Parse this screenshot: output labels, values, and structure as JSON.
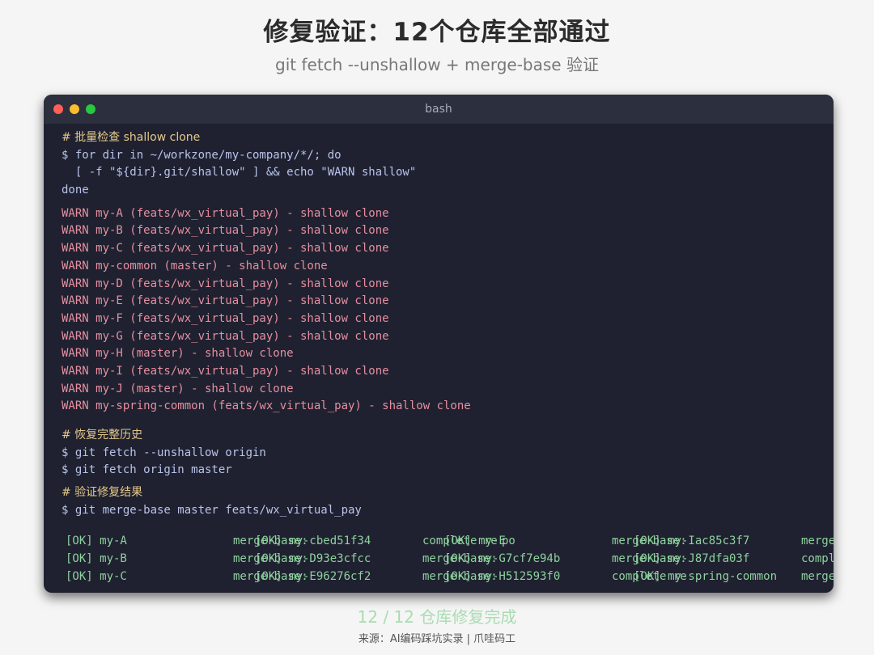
{
  "header": {
    "title": "修复验证：12个仓库全部通过",
    "subtitle": "git fetch --unshallow + merge-base 验证"
  },
  "window": {
    "title": "bash",
    "buttons": [
      "close",
      "minimize",
      "maximize"
    ]
  },
  "terminal": {
    "block1": {
      "comment": "# 批量检查 shallow clone",
      "cmd1": "$ for dir in ~/workzone/my-company/*/; do",
      "cmd2": "  [ -f \"${dir}.git/shallow\" ] && echo \"WARN shallow\"",
      "cmd3": "done"
    },
    "warnings": [
      "WARN my-A (feats/wx_virtual_pay) - shallow clone",
      "WARN my-B (feats/wx_virtual_pay) - shallow clone",
      "WARN my-C (feats/wx_virtual_pay) - shallow clone",
      "WARN my-common (master) - shallow clone",
      "WARN my-D (feats/wx_virtual_pay) - shallow clone",
      "WARN my-E (feats/wx_virtual_pay) - shallow clone",
      "WARN my-F (feats/wx_virtual_pay) - shallow clone",
      "WARN my-G (feats/wx_virtual_pay) - shallow clone",
      "WARN my-H (master) - shallow clone",
      "WARN my-I (feats/wx_virtual_pay) - shallow clone",
      "WARN my-J (master) - shallow clone",
      "WARN my-spring-common (feats/wx_virtual_pay) - shallow clone"
    ],
    "block2": {
      "comment": "# 恢复完整历史",
      "cmd1": "$ git fetch --unshallow origin",
      "cmd2": "$ git fetch origin master"
    },
    "block3": {
      "comment": "# 验证修复结果",
      "cmd1": "$ git merge-base master feats/wx_virtual_pay"
    },
    "ok_rows": [
      {
        "c1": "[OK] my-A",
        "c2a": "merge-base: ",
        "c2b": "[OK] my-cbed51f34",
        "c3a": "complete re",
        "c3b": "[OK] my-E",
        "c3c": "po",
        "c4a": "merge-base: ",
        "c4b": "[OK] my-Iac85c3f7",
        "c5": "merge-base"
      },
      {
        "c1": "[OK] my-B",
        "c2a": "merge-base: ",
        "c2b": "[OK] my-D93e3cfcc",
        "c3a": "merge-base: ",
        "c3b": "[OK] my-G7cf7e94b",
        "c3c": "",
        "c4a": "merge-base: ",
        "c4b": "[OK] my-J87dfa03f",
        "c5": "complete re"
      },
      {
        "c1": "[OK] my-C",
        "c2a": "merge-base: ",
        "c2b": "[OK] my-E96276cf2",
        "c3a": "merge-base: ",
        "c3b": "[OK] my-H512593f0",
        "c3c": "",
        "c4a": "complete re",
        "c4b": "[OK] my-spring-common",
        "c5": "merge-base"
      }
    ]
  },
  "footer": {
    "count": "12 / 12  仓库修复完成",
    "source": "来源：AI编码踩坑实录 | 爪哇码工"
  },
  "colors": {
    "background": "#f5f5f5",
    "terminal_bg": "#1f2130",
    "titlebar_bg": "#2c2f3d",
    "comment": "#e6c98b",
    "command": "#b9c3ea",
    "warn": "#e58fa0",
    "ok": "#8fd19e",
    "footer_accent": "#a8dcb1"
  }
}
